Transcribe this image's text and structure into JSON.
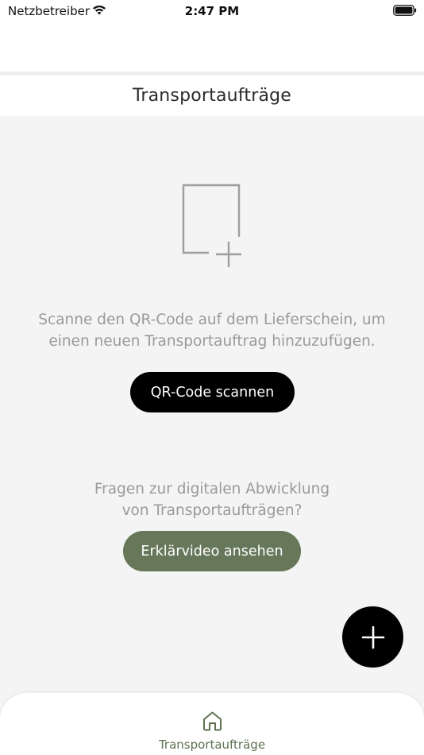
{
  "status_bar": {
    "carrier": "Netzbetreiber",
    "time": "2:47 PM",
    "wifi_icon": "wifi-icon",
    "battery_icon": "battery-icon"
  },
  "header": {
    "title": "Transportaufträge"
  },
  "empty_state": {
    "icon": "document-plus-icon",
    "message_line1": "Scanne den QR-Code auf dem Lieferschein, um",
    "message_line2": "einen neuen Transportauftrag hinzuzufügen.",
    "scan_button_label": "QR-Code scannen"
  },
  "help": {
    "line1": "Fragen zur digitalen Abwicklung",
    "line2": "von Transportaufträgen?",
    "video_button_label": "Erklärvideo ansehen"
  },
  "fab": {
    "icon": "plus-icon"
  },
  "tab_bar": {
    "items": [
      {
        "label": "Transportaufträge",
        "icon": "home-icon"
      }
    ]
  },
  "colors": {
    "accent_green": "#66775a",
    "tab_label_green": "#5f7152",
    "background": "#f4f4f4",
    "muted_text": "#9a9a9a"
  }
}
